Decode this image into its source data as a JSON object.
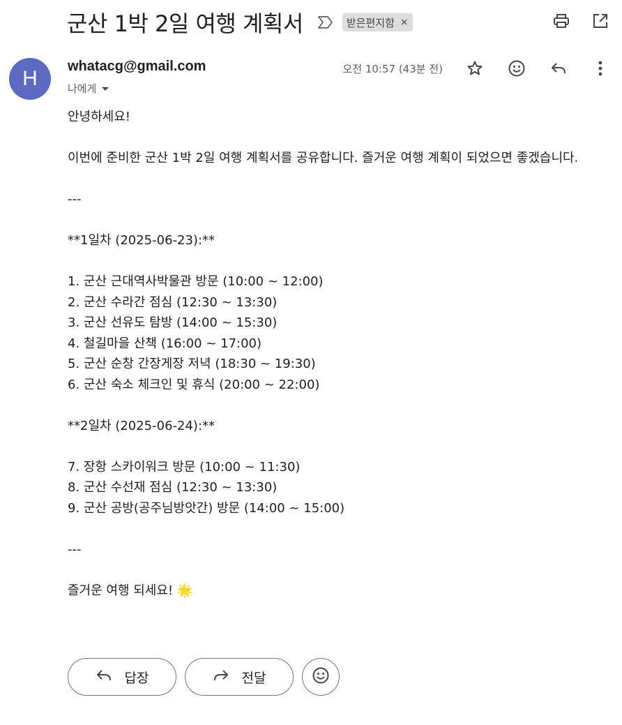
{
  "subject": "군산 1박 2일 여행 계획서",
  "label": {
    "text": "받은편지함",
    "remove": "×"
  },
  "sender": {
    "avatar_letter": "H",
    "email": "whatacg@gmail.com",
    "recipient": "나에게"
  },
  "timestamp": "오전 10:57 (43분 전)",
  "body": {
    "greeting": "안녕하세요!",
    "intro": "이번에 준비한 군산 1박 2일 여행 계획서를 공유합니다. 즐거운 여행 계획이 되었으면 좋겠습니다.",
    "divider1": "---",
    "day1_header": "**1일차 (2025-06-23):**",
    "day1_items": [
      "1. 군산 근대역사박물관 방문 (10:00 ~ 12:00)",
      "2. 군산 수라간 점심 (12:30 ~ 13:30)",
      "3. 군산 선유도 탐방 (14:00 ~ 15:30)",
      "4. 철길마을 산책 (16:00 ~ 17:00)",
      "5. 군산 순창 간장게장 저녁 (18:30 ~ 19:30)",
      "6. 군산 숙소 체크인 및 휴식 (20:00 ~ 22:00)"
    ],
    "day2_header": "**2일차 (2025-06-24):**",
    "day2_items": [
      "7. 장항 스카이워크 방문 (10:00 ~ 11:30)",
      "8. 군산 수선재 점심 (12:30 ~ 13:30)",
      "9. 군산 공방(공주님방앗간) 방문 (14:00 ~ 15:00)"
    ],
    "divider2": "---",
    "closing": "즐거운 여행 되세요! 🌟"
  },
  "actions": {
    "reply": "답장",
    "forward": "전달"
  },
  "icons": {
    "important": "important-marker-icon",
    "print": "print-icon",
    "open_new": "open-in-new-window-icon",
    "star": "star-icon",
    "emoji": "emoji-reaction-icon",
    "reply": "reply-icon",
    "more": "more-vert-icon",
    "forward": "forward-icon"
  },
  "colors": {
    "avatar": "#5c6bc0",
    "chip_bg": "#dddddd",
    "border": "#747775"
  }
}
